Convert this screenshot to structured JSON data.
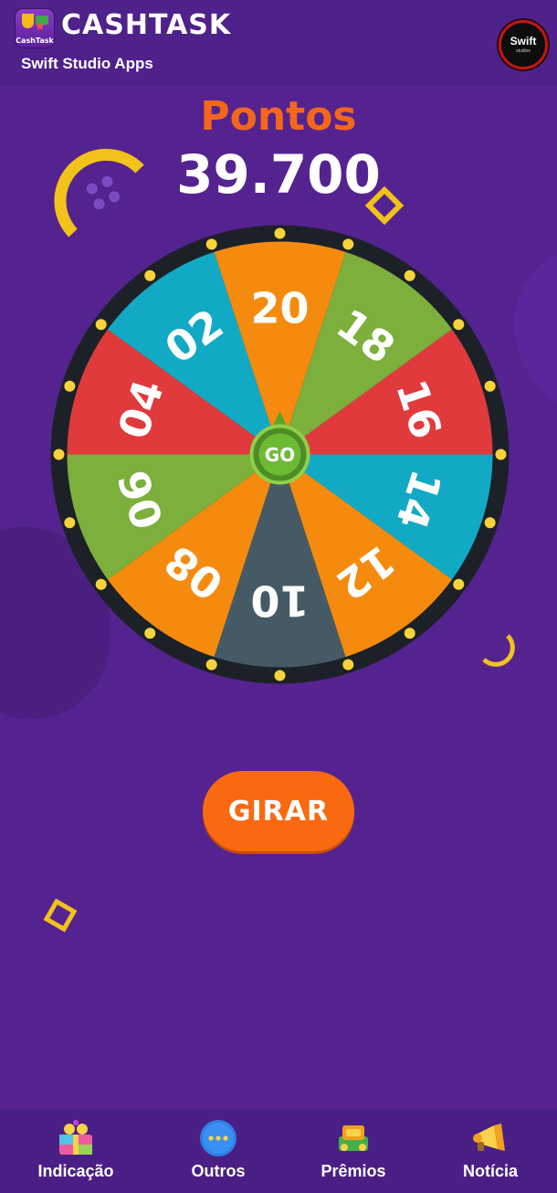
{
  "app": {
    "icon_label": "CashTask",
    "title": "CASHTASK",
    "subtitle": "Swift Studio Apps",
    "partner_logo_text": "Swift",
    "partner_logo_subtext": "studios"
  },
  "score": {
    "label": "Pontos",
    "value": "39.700"
  },
  "wheel": {
    "center_label": "GO",
    "segments": [
      {
        "label": "20",
        "color": "#f58b0e"
      },
      {
        "label": "18",
        "color": "#7caf3b"
      },
      {
        "label": "16",
        "color": "#e03a3c"
      },
      {
        "label": "14",
        "color": "#12a9c4"
      },
      {
        "label": "12",
        "color": "#f58b0e"
      },
      {
        "label": "10",
        "color": "#455a64"
      },
      {
        "label": "08",
        "color": "#f58b0e"
      },
      {
        "label": "06",
        "color": "#7caf3b"
      },
      {
        "label": "04",
        "color": "#e03a3c"
      },
      {
        "label": "02",
        "color": "#12a9c4"
      }
    ],
    "rim_color": "#222831",
    "bulb_color": "#f6d33a"
  },
  "spin_button": {
    "label": "GIRAR"
  },
  "bottom_nav": [
    {
      "label": "Indicação",
      "icon": "gift-icon"
    },
    {
      "label": "Outros",
      "icon": "more-icon"
    },
    {
      "label": "Prêmios",
      "icon": "prize-icon"
    },
    {
      "label": "Notícia",
      "icon": "megaphone-icon"
    }
  ],
  "colors": {
    "background": "#55238f",
    "accent": "#f96a10",
    "decoration": "#f2c21b"
  }
}
